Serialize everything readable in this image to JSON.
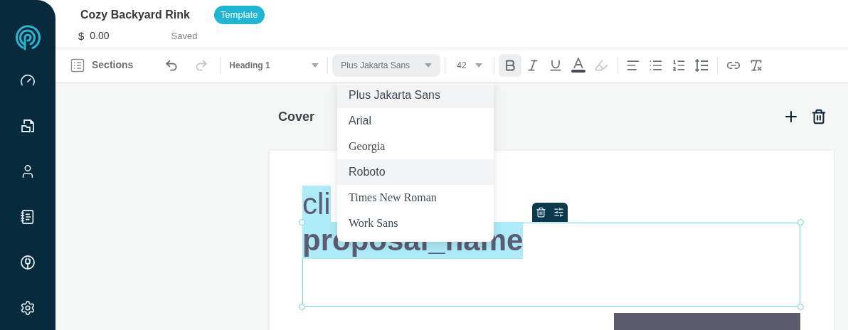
{
  "document": {
    "title": "Cozy Backyard Rink",
    "badge": "Template",
    "currency": "$",
    "amount": "0.00",
    "save_status": "Saved"
  },
  "toolbar": {
    "sections_label": "Sections",
    "undo_disabled": false,
    "redo_disabled": true,
    "block_style": "Heading 1",
    "font_family": "Plus Jakarta Sans",
    "font_size": "42",
    "tools": [
      {
        "kind": "bold",
        "active": true,
        "disabled": false
      },
      {
        "kind": "italic",
        "active": false,
        "disabled": false
      },
      {
        "kind": "underline",
        "active": false,
        "disabled": false
      },
      {
        "kind": "text_color",
        "active": false,
        "disabled": false,
        "color": "#4b4b5c"
      },
      {
        "kind": "highlight",
        "active": false,
        "disabled": true
      },
      {
        "kind": "align_left",
        "active": false,
        "disabled": false
      },
      {
        "kind": "bullet_list",
        "active": false,
        "disabled": false
      },
      {
        "kind": "numbered_list",
        "active": false,
        "disabled": false
      },
      {
        "kind": "line_height",
        "active": false,
        "disabled": false
      },
      {
        "kind": "link",
        "active": false,
        "disabled": false
      },
      {
        "kind": "clear_format",
        "active": false,
        "disabled": false
      }
    ]
  },
  "font_menu": {
    "options": [
      {
        "label": "Plus Jakarta Sans",
        "kind": "sans",
        "highlighted": true
      },
      {
        "label": "Arial",
        "kind": "sans",
        "highlighted": false
      },
      {
        "label": "Georgia",
        "kind": "serif",
        "highlighted": false
      },
      {
        "label": "Roboto",
        "kind": "sans",
        "highlighted": true
      },
      {
        "label": "Times New Roman",
        "kind": "serif",
        "highlighted": false
      },
      {
        "label": "Work Sans",
        "kind": "serif",
        "highlighted": false
      }
    ]
  },
  "section": {
    "title": "Cover"
  },
  "cover": {
    "selected": true,
    "heading_lines": [
      {
        "text": "cli",
        "bold": false,
        "highlighted": true
      },
      {
        "text": "proposal_name",
        "bold": true,
        "highlighted": true
      }
    ]
  }
}
